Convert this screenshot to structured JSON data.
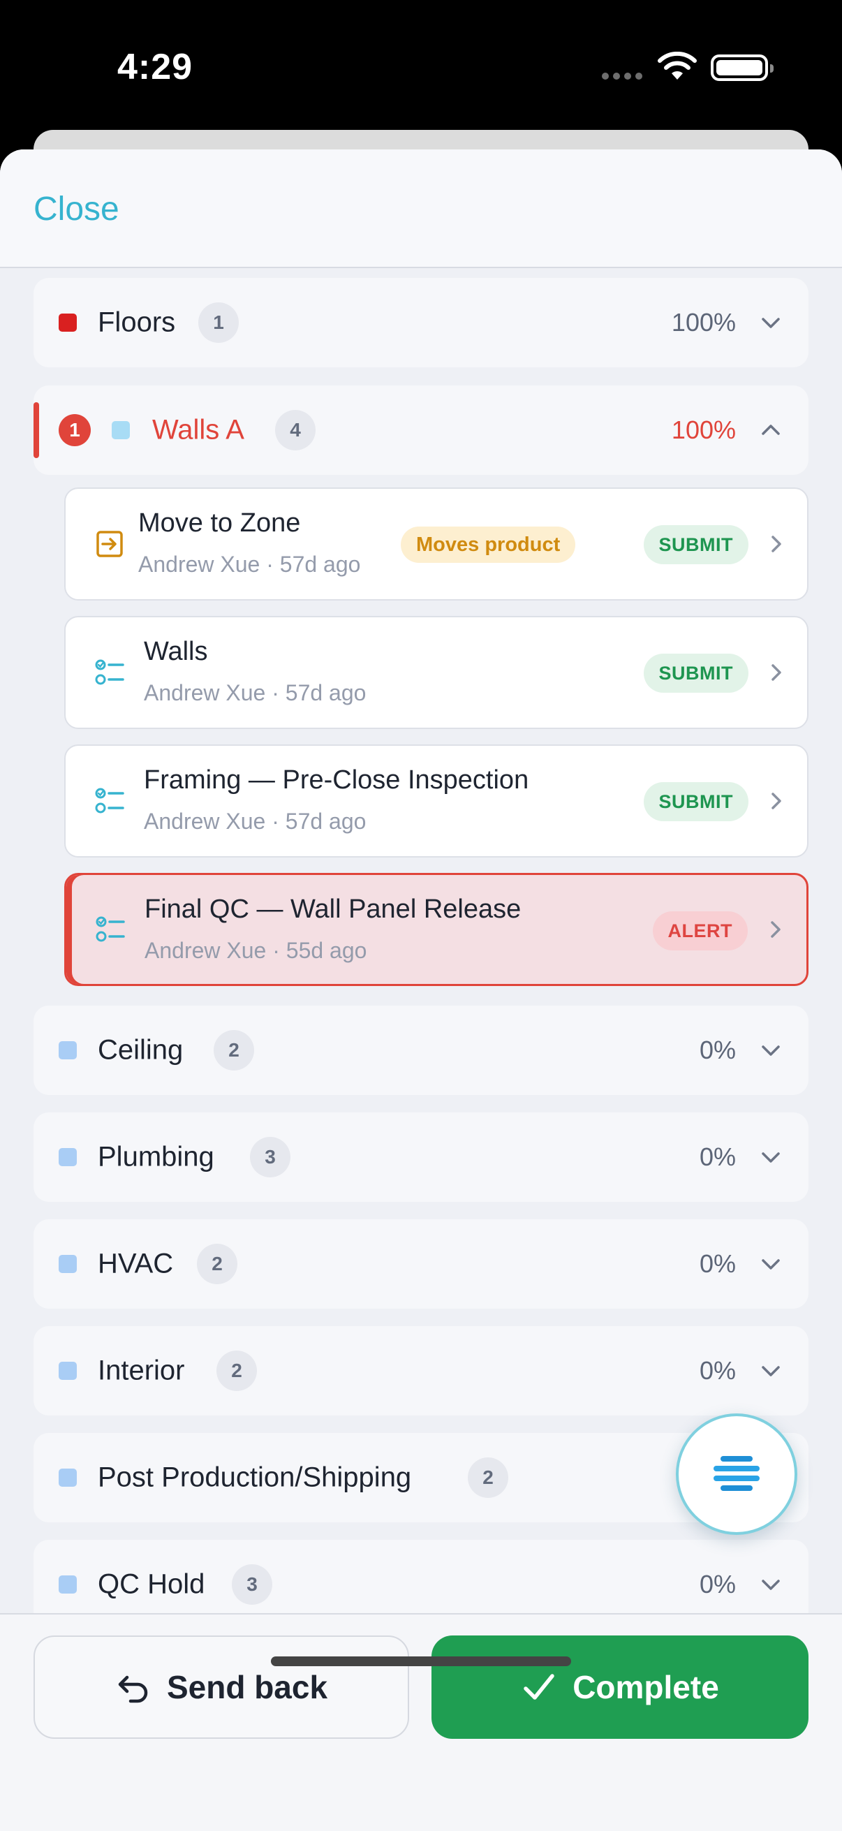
{
  "status_bar": {
    "time": "4:29"
  },
  "header": {
    "close_label": "Close"
  },
  "groups": [
    {
      "name": "Floors",
      "count": "1",
      "percent": "100%",
      "color": "#d92020",
      "expanded": false
    },
    {
      "name": "Walls A",
      "count": "4",
      "percent": "100%",
      "color": "#a8dcf5",
      "expanded": true,
      "alert_count": "1"
    },
    {
      "name": "Ceiling",
      "count": "2",
      "percent": "0%",
      "color": "#a9cdf5",
      "expanded": false
    },
    {
      "name": "Plumbing",
      "count": "3",
      "percent": "0%",
      "color": "#a9cdf5",
      "expanded": false
    },
    {
      "name": "HVAC",
      "count": "2",
      "percent": "0%",
      "color": "#a9cdf5",
      "expanded": false
    },
    {
      "name": "Interior",
      "count": "2",
      "percent": "0%",
      "color": "#a9cdf5",
      "expanded": false
    },
    {
      "name": "Post Production/Shipping",
      "count": "2",
      "percent": "",
      "color": "#a9cdf5",
      "expanded": false
    },
    {
      "name": "QC Hold",
      "count": "3",
      "percent": "0%",
      "color": "#a9cdf5",
      "expanded": false
    }
  ],
  "tasks": [
    {
      "title": "Move to Zone",
      "subtitle": "Andrew Xue · 57d ago",
      "tag": "Moves product",
      "status": "SUBMIT",
      "icon": "move-to-zone-icon"
    },
    {
      "title": "Walls",
      "subtitle": "Andrew Xue · 57d ago",
      "status": "SUBMIT",
      "icon": "checklist-icon"
    },
    {
      "title": "Framing — Pre-Close Inspection",
      "subtitle": "Andrew Xue · 57d ago",
      "status": "SUBMIT",
      "icon": "checklist-icon"
    },
    {
      "title": "Final QC — Wall Panel Release",
      "subtitle": "Andrew Xue · 55d ago",
      "status": "ALERT",
      "icon": "checklist-icon"
    }
  ],
  "actions": {
    "send_back_label": "Send back",
    "complete_label": "Complete"
  },
  "colors": {
    "accent": "#36b3cf",
    "alert": "#e0443a",
    "success": "#1f9e52",
    "tag_warning": "#d08b10"
  }
}
